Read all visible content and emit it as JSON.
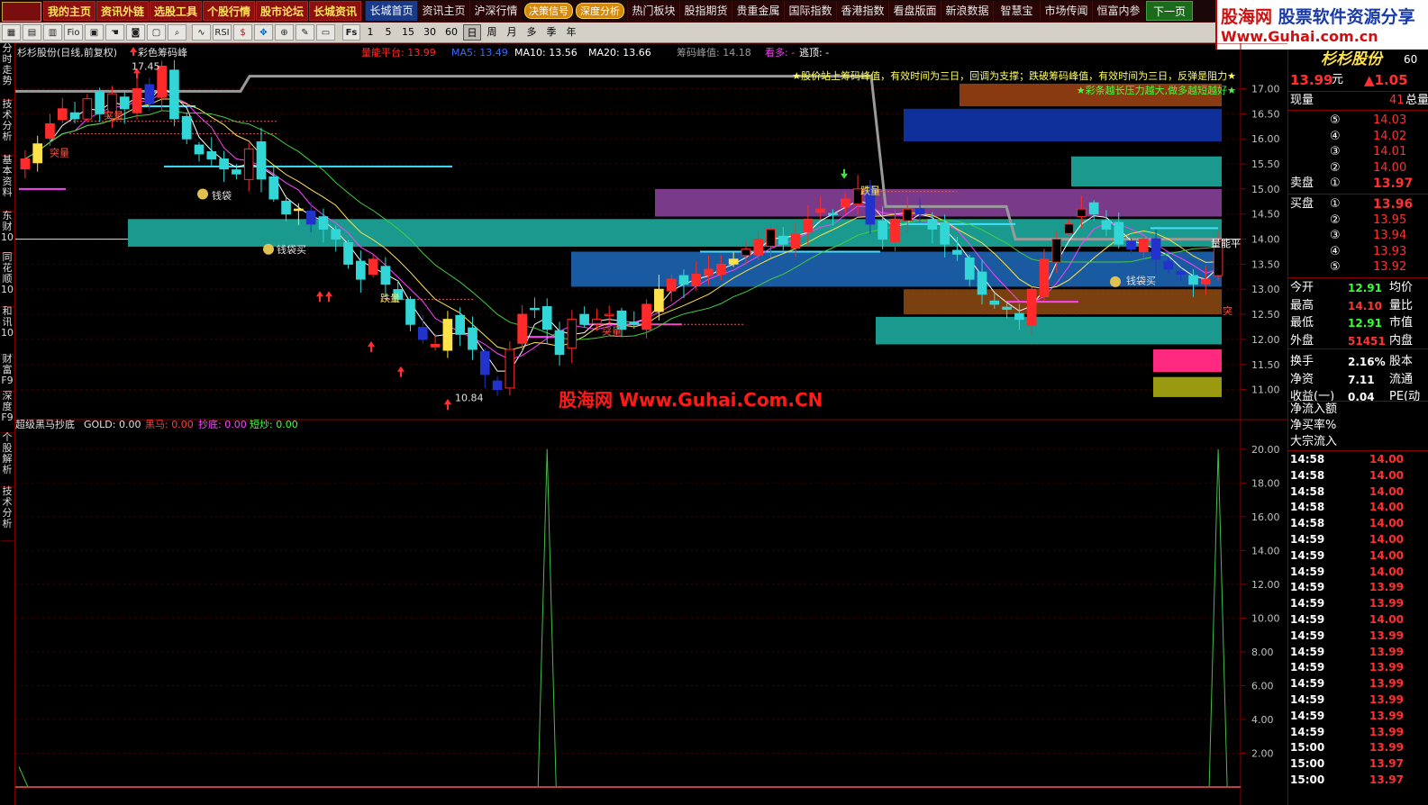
{
  "topnav": {
    "items": [
      "我的主页",
      "资讯外链",
      "选股工具",
      "个股行情",
      "股市论坛",
      "长城资讯"
    ],
    "items2": [
      "长城首页",
      "资讯主页",
      "沪深行情"
    ],
    "special": [
      "决策信号",
      "深度分析"
    ],
    "items3": [
      "热门板块",
      "股指期货",
      "贵重金属",
      "国际指数",
      "香港指数",
      "看盘版面",
      "新浪数据",
      "智慧宝",
      "市场传闻",
      "恒富内参"
    ],
    "next": "下一页>>"
  },
  "logo": {
    "line1a": "股海网",
    "line1b": "股票软件资源分享",
    "line2": "Www.Guhai.com.cn"
  },
  "toolbar": {
    "icons": [
      "grid-icon",
      "table-icon",
      "line-icon",
      "fio-icon",
      "doc-icon",
      "hand-icon",
      "camera-icon",
      "box-icon",
      "zoom-icon",
      "wave-icon",
      "rsi-icon",
      "dollar-icon",
      "move-icon",
      "compass-icon",
      "pen-icon",
      "page-icon"
    ],
    "rsi": "RSI",
    "fs": "Fs",
    "periods": [
      "1",
      "5",
      "15",
      "30",
      "60",
      "日",
      "周",
      "月",
      "多",
      "季",
      "年"
    ],
    "selected_period": "日"
  },
  "vtabs": [
    "分时走势",
    "技术分析",
    "基本资料",
    "东财10",
    "同花顺10",
    "和讯10",
    "财富F9",
    "深度F9",
    "个股解析",
    "技术分析"
  ],
  "chart": {
    "title": "杉杉股份(日线,前复权)",
    "indicator": "彩色筹码峰",
    "legend": [
      {
        "label": "量能平台: 13.99",
        "color": "#ff2a2a"
      },
      {
        "label": "MA5: 13.49",
        "color": "#3a6aff"
      },
      {
        "label": "MA10: 13.56",
        "color": "#ffffff"
      },
      {
        "label": "MA20: 13.66",
        "color": "#ffffff"
      },
      {
        "label": "筹码峰值: 14.18",
        "color": "#9a9a9a"
      },
      {
        "label": "看多: -",
        "color": "#ff3aff"
      },
      {
        "label": "逃顶: -",
        "color": "#ffffff"
      }
    ],
    "note1": "★股价站上筹码峰值，有效时间为三日，回调为支撑；跌破筹码峰值，有效时间为三日，反弹是阻力★",
    "note2": "★彩条越长压力越大,做多越短越好★",
    "price_axis": [
      "17.00",
      "16.50",
      "16.00",
      "15.50",
      "15.00",
      "14.50",
      "14.00",
      "13.50",
      "13.00",
      "12.50",
      "12.00",
      "11.50",
      "11.00"
    ],
    "high_label": "17.45",
    "low_label": "10.84",
    "labels_jiqun": "钱袋",
    "labels_qdm": "钱袋买",
    "labels_tb": "突量",
    "labels_dl": "跌量",
    "label_lnp": "量能平",
    "label_tu": "突",
    "chart_data": {
      "type": "candlestick",
      "high": 17.45,
      "low": 10.84,
      "last": 13.99,
      "ma": {
        "MA5": 13.49,
        "MA10": 13.56,
        "MA20": 13.66
      },
      "platform": 13.99,
      "chip_peak": 14.18,
      "close_series": [
        15.6,
        15.9,
        16.3,
        16.6,
        16.4,
        16.8,
        16.5,
        16.9,
        16.6,
        17.0,
        16.7,
        17.45,
        16.4,
        16.0,
        15.7,
        15.6,
        15.4,
        15.3,
        15.8,
        15.2,
        14.8,
        14.5,
        14.6,
        14.3,
        14.2,
        14.0,
        13.5,
        13.2,
        13.6,
        13.1,
        12.8,
        12.3,
        12.0,
        11.9,
        12.4,
        12.1,
        11.8,
        11.3,
        11.0,
        11.8,
        12.5,
        12.6,
        12.2,
        11.7,
        12.4,
        12.3,
        12.4,
        12.5,
        12.2,
        12.3,
        12.7,
        13.0,
        13.2,
        13.1,
        13.3,
        13.4,
        13.5,
        13.6,
        13.8,
        14.0,
        14.2,
        13.9,
        14.1,
        14.4,
        14.6,
        14.5,
        14.8,
        15.0,
        14.3,
        14.0,
        14.4,
        14.6,
        14.5,
        14.2,
        13.9,
        13.7,
        13.2,
        12.9,
        12.7,
        12.6,
        12.4,
        13.0,
        13.6,
        14.0,
        14.3,
        14.6,
        14.5,
        14.2,
        13.9,
        13.8,
        14.0,
        13.6,
        13.4,
        13.3,
        13.1,
        13.2,
        13.99
      ]
    }
  },
  "indicator": {
    "title": "超级黑马抄底",
    "gold": "GOLD: 0.00",
    "heima": "黑马: 0.00",
    "chaodi": "抄底: 0.00",
    "duanchao": "短炒: 0.00",
    "axis": [
      "20.00",
      "18.00",
      "16.00",
      "14.00",
      "12.00",
      "10.00",
      "8.00",
      "6.00",
      "4.00",
      "2.00"
    ],
    "chart_data": {
      "type": "line",
      "spikes": [
        {
          "index": 42,
          "value": 20
        },
        {
          "index": 96,
          "value": 20
        }
      ],
      "ylim": [
        0,
        20
      ]
    }
  },
  "right": {
    "stock": "杉杉股份",
    "code": "60",
    "price": "13.99",
    "unit": "元",
    "change": "▲1.05",
    "xianliang": "现量",
    "xianliang_val": "41",
    "zongliang": "总量",
    "asks": [
      {
        "n": "⑤",
        "p": "14.03"
      },
      {
        "n": "④",
        "p": "14.02"
      },
      {
        "n": "③",
        "p": "14.01"
      },
      {
        "n": "②",
        "p": "14.00"
      },
      {
        "n": "①",
        "p": "13.97"
      }
    ],
    "ask_label": "卖盘",
    "bid_label": "买盘",
    "bids": [
      {
        "n": "①",
        "p": "13.96"
      },
      {
        "n": "②",
        "p": "13.95"
      },
      {
        "n": "③",
        "p": "13.94"
      },
      {
        "n": "④",
        "p": "13.93"
      },
      {
        "n": "⑤",
        "p": "13.92"
      }
    ],
    "stats": [
      {
        "k": "今开",
        "v": "12.91",
        "k2": "均价",
        "c": "#33ff33"
      },
      {
        "k": "最高",
        "v": "14.10",
        "k2": "量比",
        "c": "#ff3333"
      },
      {
        "k": "最低",
        "v": "12.91",
        "k2": "市值",
        "c": "#33ff33"
      },
      {
        "k": "外盘",
        "v": "51451",
        "k2": "内盘",
        "c": "#ff3333"
      },
      {
        "k": "换手",
        "v": "2.16%",
        "k2": "股本",
        "c": "#ffffff"
      },
      {
        "k": "净资",
        "v": "7.11",
        "k2": "流通",
        "c": "#ffffff"
      },
      {
        "k": "收益(一)",
        "v": "0.04",
        "k2": "PE(动",
        "c": "#ffffff"
      }
    ],
    "flows": [
      "净流入额",
      "净买率%",
      "大宗流入"
    ],
    "ticks": [
      {
        "t": "14:58",
        "p": "14.00"
      },
      {
        "t": "14:58",
        "p": "14.00"
      },
      {
        "t": "14:58",
        "p": "14.00"
      },
      {
        "t": "14:58",
        "p": "14.00"
      },
      {
        "t": "14:58",
        "p": "14.00"
      },
      {
        "t": "14:59",
        "p": "14.00"
      },
      {
        "t": "14:59",
        "p": "14.00"
      },
      {
        "t": "14:59",
        "p": "14.00"
      },
      {
        "t": "14:59",
        "p": "13.99"
      },
      {
        "t": "14:59",
        "p": "13.99"
      },
      {
        "t": "14:59",
        "p": "14.00"
      },
      {
        "t": "14:59",
        "p": "13.99"
      },
      {
        "t": "14:59",
        "p": "13.99"
      },
      {
        "t": "14:59",
        "p": "13.99"
      },
      {
        "t": "14:59",
        "p": "13.99"
      },
      {
        "t": "14:59",
        "p": "13.99"
      },
      {
        "t": "14:59",
        "p": "13.99"
      },
      {
        "t": "14:59",
        "p": "13.99"
      },
      {
        "t": "15:00",
        "p": "13.99"
      },
      {
        "t": "15:00",
        "p": "13.97"
      },
      {
        "t": "15:00",
        "p": "13.97"
      }
    ]
  },
  "watermark": "股海网 Www.Guhai.Com.CN"
}
